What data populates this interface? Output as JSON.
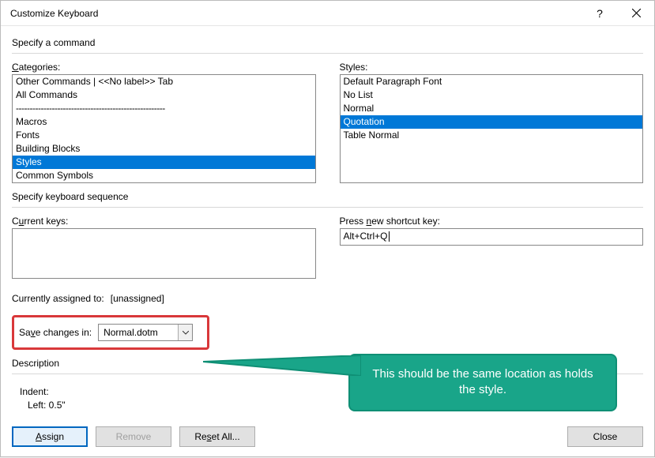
{
  "title": "Customize Keyboard",
  "sections": {
    "specifyCommand": "Specify a command",
    "specifySequence": "Specify keyboard sequence",
    "description": "Description"
  },
  "labels": {
    "categories": "Categories:",
    "styles": "Styles:",
    "currentKeys": "Current keys:",
    "pressNew": "Press new shortcut key:",
    "assignedTo": "Currently assigned to:",
    "assignedValue": "[unassigned]",
    "saveChanges": "Save changes in:",
    "indent": "Indent:",
    "indentLeft": "Left:  0.5\""
  },
  "categories": [
    {
      "label": "Other Commands | <<No label>> Tab",
      "selected": false
    },
    {
      "label": "All Commands",
      "selected": false
    },
    {
      "label": "------------------------------------------------------",
      "selected": false,
      "dashes": true
    },
    {
      "label": "Macros",
      "selected": false
    },
    {
      "label": "Fonts",
      "selected": false
    },
    {
      "label": "Building Blocks",
      "selected": false
    },
    {
      "label": "Styles",
      "selected": true
    },
    {
      "label": "Common Symbols",
      "selected": false
    }
  ],
  "styles": [
    {
      "label": "Default Paragraph Font",
      "selected": false
    },
    {
      "label": "No List",
      "selected": false
    },
    {
      "label": "Normal",
      "selected": false
    },
    {
      "label": "Quotation",
      "selected": true
    },
    {
      "label": "Table Normal",
      "selected": false
    }
  ],
  "shortcutInput": "Alt+Ctrl+Q",
  "saveTarget": "Normal.dotm",
  "buttons": {
    "assign": "Assign",
    "remove": "Remove",
    "resetAll": "Reset All...",
    "close": "Close"
  },
  "callout": "This should be the same location as holds the style."
}
